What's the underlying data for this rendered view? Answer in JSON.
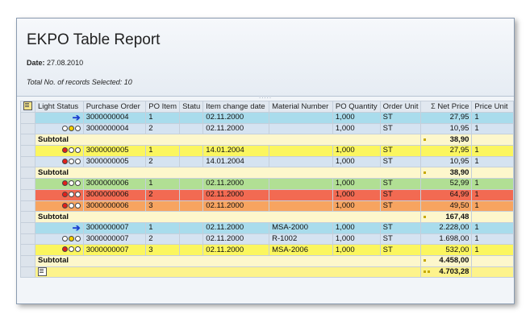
{
  "report": {
    "title": "EKPO Table Report",
    "date_label": "Date:",
    "date_value": "27.08.2010",
    "total_text": "Total No. of records Selected: 10"
  },
  "columns": [
    "Light Status",
    "Purchase Order",
    "PO Item",
    "Statu",
    "Item change date",
    "Material Number",
    "PO Quantity",
    "Order Unit",
    "Net Price",
    "Price Unit"
  ],
  "colors": {
    "blue": "#a9dcec",
    "lightblue": "#d5e3f1",
    "yellow": "#fbf65f",
    "green": "#b1df94",
    "red": "#f26a52",
    "orange": "#f7a460"
  },
  "rows": [
    {
      "type": "data",
      "color": "blue",
      "light": "arrow",
      "po": "3000000004",
      "item": "1",
      "status": "",
      "date": "02.11.2000",
      "material": "",
      "qty": "1,000",
      "unit": "ST",
      "price": "27,95",
      "price_unit": "1"
    },
    {
      "type": "data",
      "color": "lightblue",
      "light": "yellow",
      "po": "3000000004",
      "item": "2",
      "status": "",
      "date": "02.11.2000",
      "material": "",
      "qty": "1,000",
      "unit": "ST",
      "price": "10,95",
      "price_unit": "1"
    },
    {
      "type": "subtotal",
      "label": "Subtotal",
      "price": "38,90"
    },
    {
      "type": "data",
      "color": "yellow",
      "light": "red",
      "po": "3000000005",
      "item": "1",
      "status": "",
      "date": "14.01.2004",
      "material": "",
      "qty": "1,000",
      "unit": "ST",
      "price": "27,95",
      "price_unit": "1"
    },
    {
      "type": "data",
      "color": "lightblue",
      "light": "red",
      "po": "3000000005",
      "item": "2",
      "status": "",
      "date": "14.01.2004",
      "material": "",
      "qty": "1,000",
      "unit": "ST",
      "price": "10,95",
      "price_unit": "1"
    },
    {
      "type": "subtotal",
      "label": "Subtotal",
      "price": "38,90"
    },
    {
      "type": "data",
      "color": "green",
      "light": "red",
      "po": "3000000006",
      "item": "1",
      "status": "",
      "date": "02.11.2000",
      "material": "",
      "qty": "1,000",
      "unit": "ST",
      "price": "52,99",
      "price_unit": "1"
    },
    {
      "type": "data",
      "color": "red",
      "light": "red",
      "po": "3000000006",
      "item": "2",
      "status": "",
      "date": "02.11.2000",
      "material": "",
      "qty": "1,000",
      "unit": "ST",
      "price": "64,99",
      "price_unit": "1"
    },
    {
      "type": "data",
      "color": "orange",
      "light": "red",
      "po": "3000000006",
      "item": "3",
      "status": "",
      "date": "02.11.2000",
      "material": "",
      "qty": "1,000",
      "unit": "ST",
      "price": "49,50",
      "price_unit": "1"
    },
    {
      "type": "subtotal",
      "label": "Subtotal",
      "price": "167,48"
    },
    {
      "type": "data",
      "color": "blue",
      "light": "arrow",
      "po": "3000000007",
      "item": "1",
      "status": "",
      "date": "02.11.2000",
      "material": "MSA-2000",
      "qty": "1,000",
      "unit": "ST",
      "price": "2.228,00",
      "price_unit": "1"
    },
    {
      "type": "data",
      "color": "lightblue",
      "light": "yellow",
      "po": "3000000007",
      "item": "2",
      "status": "",
      "date": "02.11.2000",
      "material": "R-1002",
      "qty": "1,000",
      "unit": "ST",
      "price": "1.698,00",
      "price_unit": "1"
    },
    {
      "type": "data",
      "color": "yellow",
      "light": "red",
      "po": "3000000007",
      "item": "3",
      "status": "",
      "date": "02.11.2000",
      "material": "MSA-2006",
      "qty": "1,000",
      "unit": "ST",
      "price": "532,00",
      "price_unit": "1"
    },
    {
      "type": "subtotal",
      "label": "Subtotal",
      "price": "4.458,00"
    },
    {
      "type": "grand",
      "label": "",
      "price": "4.703,28"
    }
  ]
}
